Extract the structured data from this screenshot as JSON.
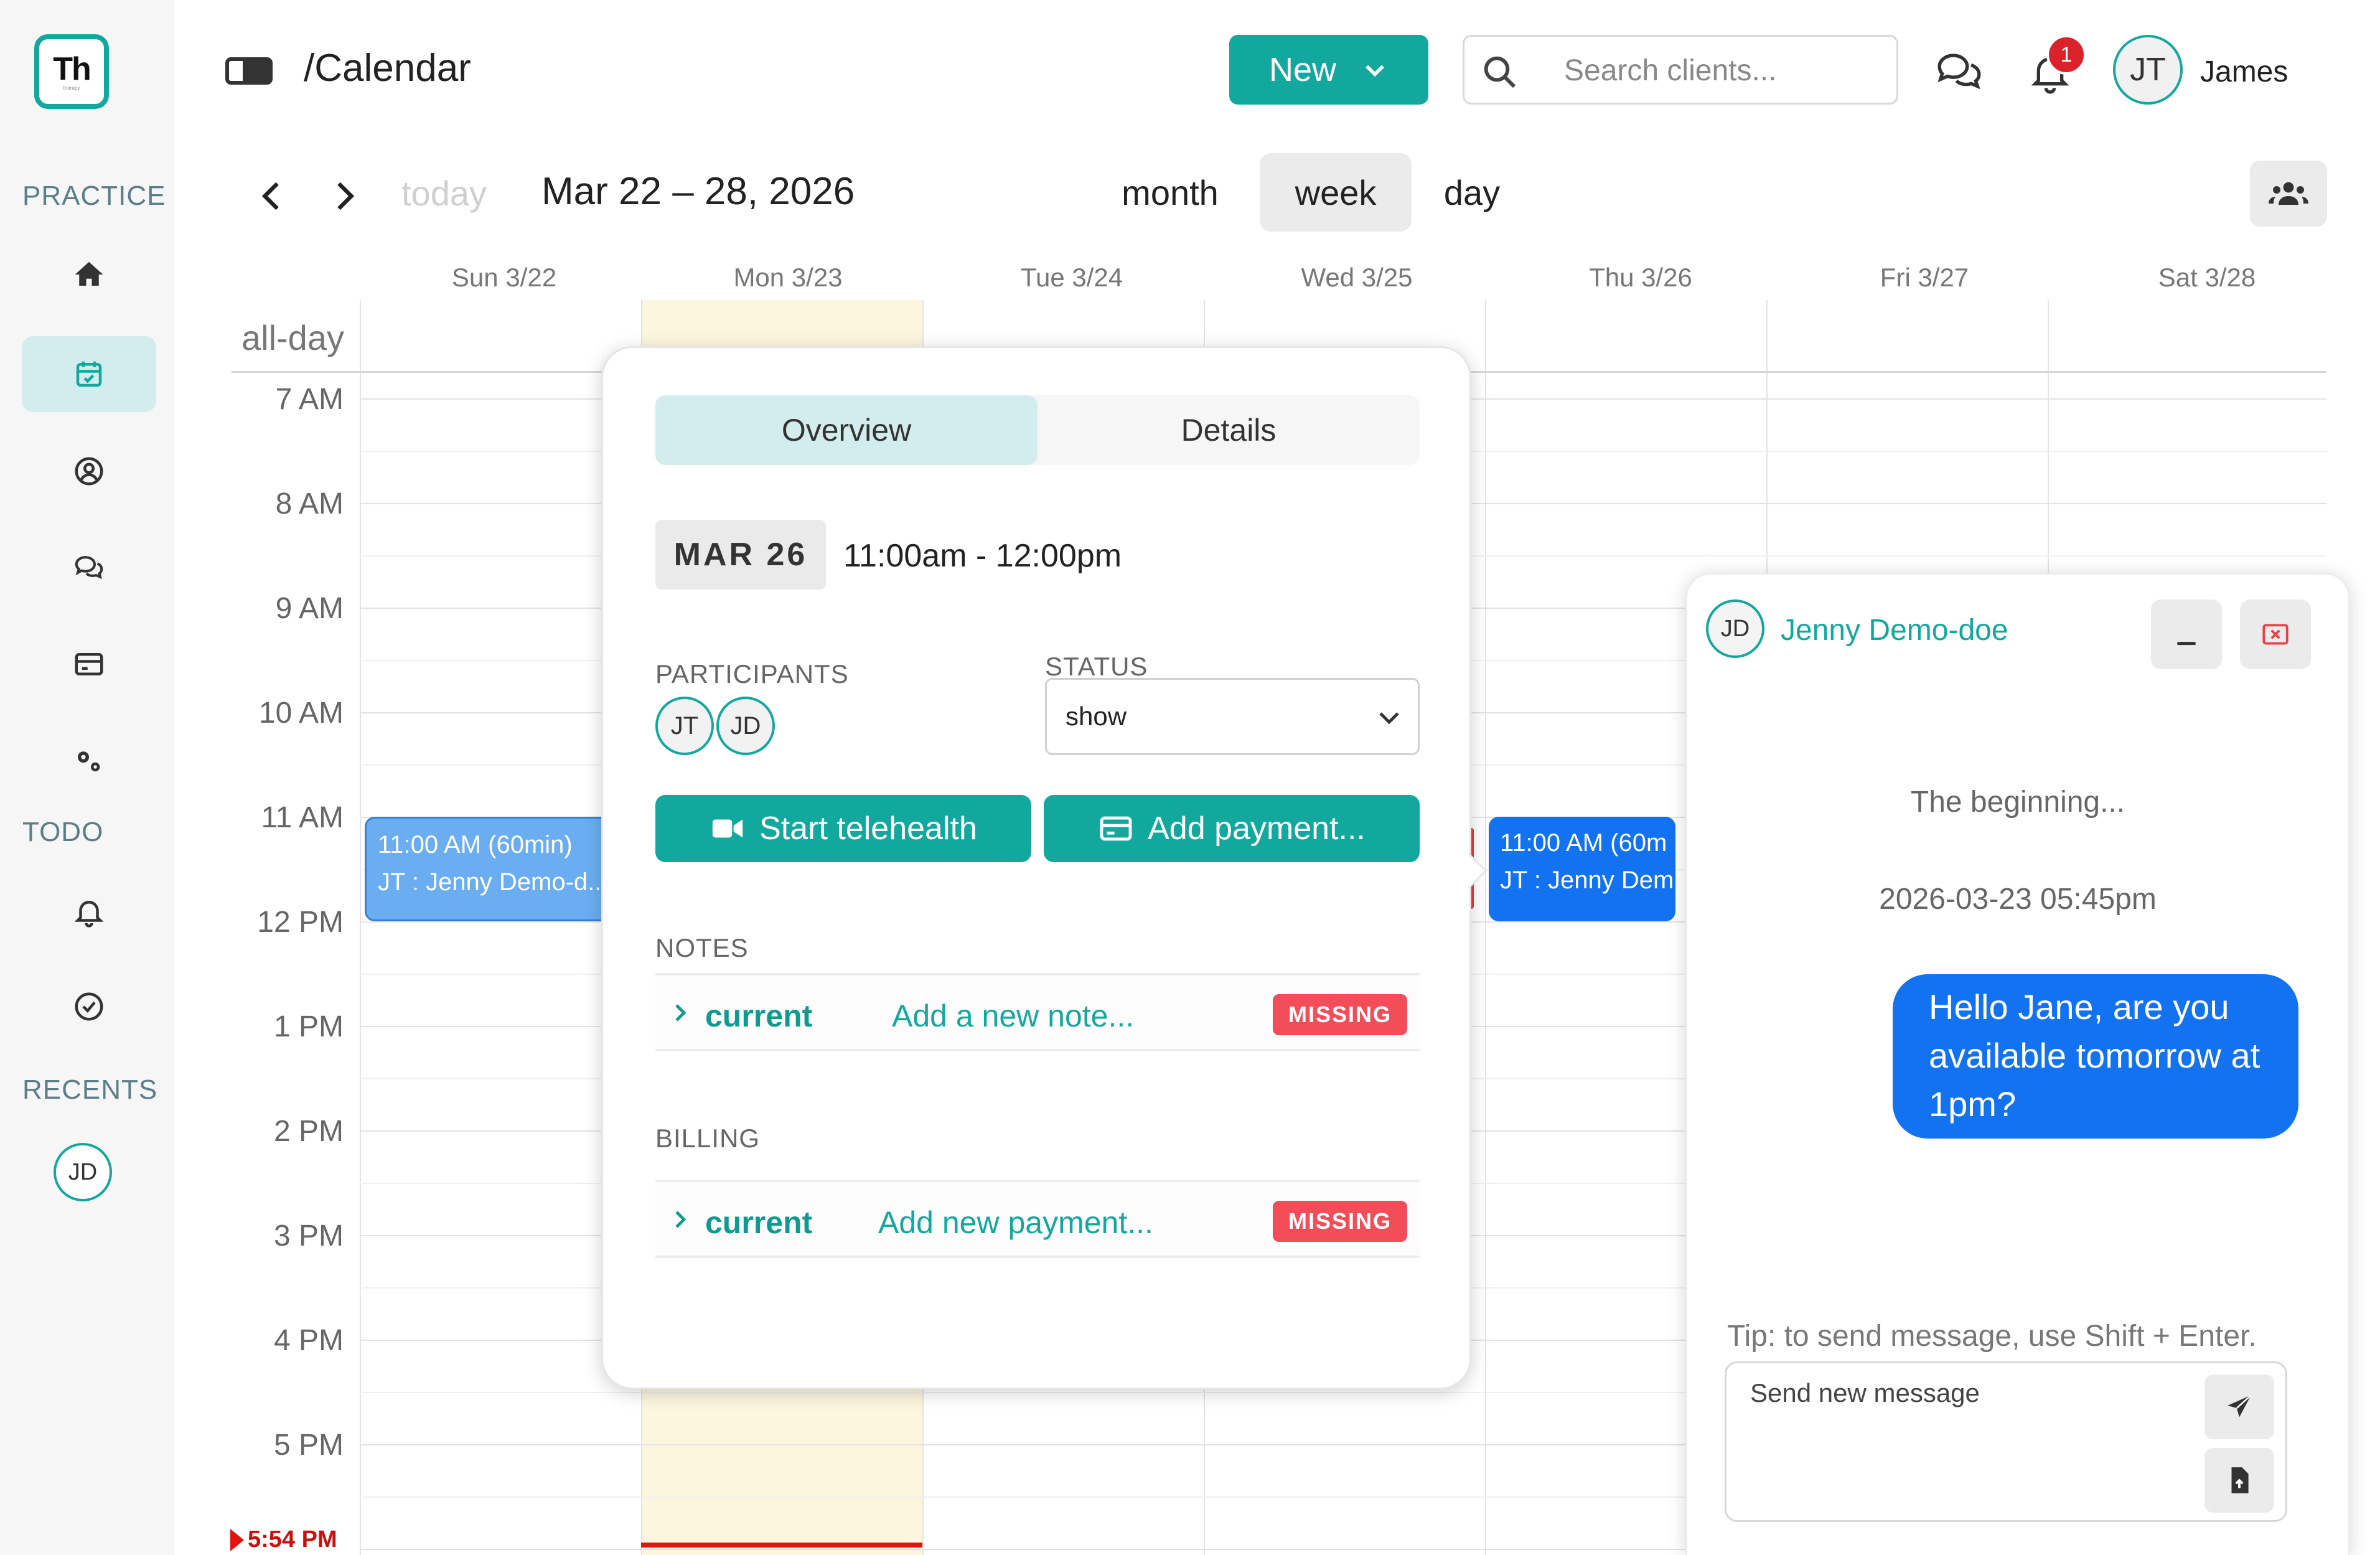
{
  "app": {
    "logo_text": "Th",
    "logo_subtext": "therapy"
  },
  "sidebar": {
    "sections": {
      "practice": "PRACTICE",
      "todo": "TODO",
      "recents": "RECENTS"
    },
    "items": [
      {
        "icon": "home-icon"
      },
      {
        "icon": "calendar-icon",
        "active": true
      },
      {
        "icon": "user-circle-icon"
      },
      {
        "icon": "messages-icon"
      },
      {
        "icon": "credit-card-icon"
      },
      {
        "icon": "gears-icon"
      },
      {
        "icon": "bell-icon"
      },
      {
        "icon": "check-circle-icon"
      }
    ],
    "recents": [
      {
        "initials": "JD"
      }
    ]
  },
  "header": {
    "title": "/Calendar",
    "new_button": "New",
    "search_placeholder": "Search clients...",
    "notification_count": "1",
    "user_initials": "JT",
    "user_name": "James"
  },
  "calendar": {
    "today_label": "today",
    "date_range": "Mar 22 – 28, 2026",
    "views": [
      "month",
      "week",
      "day"
    ],
    "active_view": "week",
    "days": [
      "Sun 3/22",
      "Mon 3/23",
      "Tue 3/24",
      "Wed 3/25",
      "Thu 3/26",
      "Fri 3/27",
      "Sat 3/28"
    ],
    "today_index": 1,
    "allday_label": "all-day",
    "hours": [
      "7 AM",
      "8 AM",
      "9 AM",
      "10 AM",
      "11 AM",
      "12 PM",
      "1 PM",
      "2 PM",
      "3 PM",
      "4 PM",
      "5 PM"
    ],
    "now_label": "5:54 PM",
    "events": [
      {
        "day": "Sun",
        "time": "11:00 AM (60min)",
        "title": "JT : Jenny Demo-d..."
      },
      {
        "day": "Thu",
        "time": "11:00 AM (60m",
        "title": "JT : Jenny Dem"
      }
    ]
  },
  "popover": {
    "tabs": [
      "Overview",
      "Details"
    ],
    "active_tab": "Overview",
    "date_chip": "MAR 26",
    "time_range": "11:00am - 12:00pm",
    "participants_label": "PARTICIPANTS",
    "participants": [
      "JT",
      "JD"
    ],
    "status_label": "STATUS",
    "status_value": "show",
    "telehealth_button": "Start telehealth",
    "payment_button": "Add payment...",
    "notes_label": "NOTES",
    "notes_row": {
      "current": "current",
      "link": "Add a new note...",
      "badge": "MISSING"
    },
    "billing_label": "BILLING",
    "billing_row": {
      "current": "current",
      "link": "Add new payment...",
      "badge": "MISSING"
    }
  },
  "chat": {
    "initials": "JD",
    "name": "Jenny Demo-doe",
    "beginning": "The beginning...",
    "timestamp": "2026-03-23 05:45pm",
    "message": "Hello Jane, are you available tomorrow at 1pm?",
    "tip": "Tip: to send message, use Shift + Enter.",
    "input_placeholder": "Send new message"
  },
  "colors": {
    "accent": "#13a89e",
    "event_light": "#6aaef1",
    "event_dark": "#1272f0",
    "badge_red": "#f24d58",
    "today_bg": "#fcf6df",
    "now_line": "#e3140f"
  }
}
